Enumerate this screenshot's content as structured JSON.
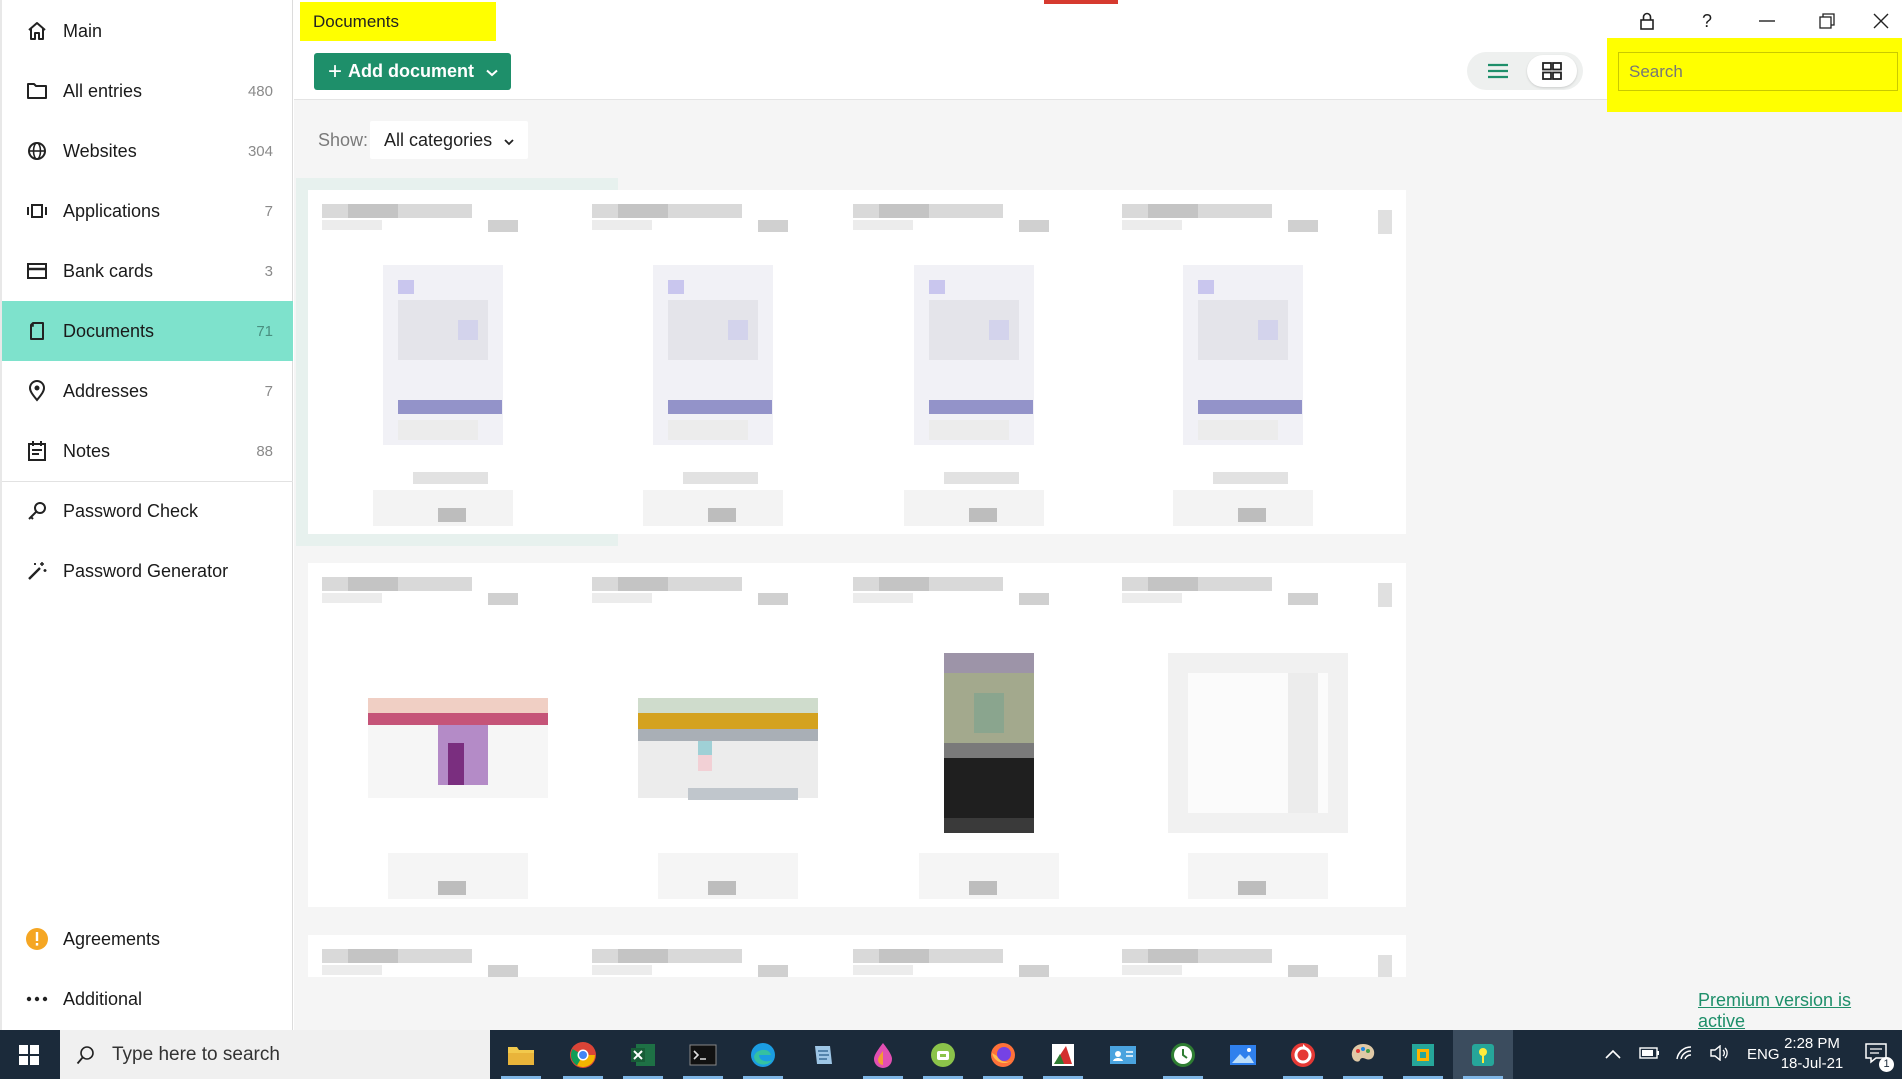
{
  "sidebar": {
    "items": [
      {
        "label": "Main",
        "count": "",
        "icon": "home-icon"
      },
      {
        "label": "All entries",
        "count": "480",
        "icon": "folder-icon"
      },
      {
        "label": "Websites",
        "count": "304",
        "icon": "globe-icon"
      },
      {
        "label": "Applications",
        "count": "7",
        "icon": "applications-icon"
      },
      {
        "label": "Bank cards",
        "count": "3",
        "icon": "credit-card-icon"
      },
      {
        "label": "Documents",
        "count": "71",
        "icon": "document-icon",
        "active": true
      },
      {
        "label": "Addresses",
        "count": "7",
        "icon": "location-pin-icon"
      },
      {
        "label": "Notes",
        "count": "88",
        "icon": "notes-icon"
      },
      {
        "label": "Password Check",
        "count": "",
        "icon": "key-icon"
      },
      {
        "label": "Password Generator",
        "count": "",
        "icon": "magic-wand-icon"
      }
    ],
    "bottom": [
      {
        "label": "Agreements",
        "icon": "warning-icon"
      },
      {
        "label": "Additional",
        "icon": "more-icon"
      }
    ]
  },
  "header": {
    "title": "Documents",
    "add_button": "Add document",
    "search_placeholder": "Search"
  },
  "filter": {
    "show_label": "Show:",
    "category": "All categories"
  },
  "footer": {
    "premium": "Premium version is active"
  },
  "taskbar": {
    "search_placeholder": "Type here to search",
    "language": "ENG",
    "time": "2:28 PM",
    "date": "18-Jul-21",
    "notification_count": "1"
  },
  "colors": {
    "accent": "#1e8f6a",
    "active_nav": "#7ee2cc",
    "highlight": "#ffff00"
  }
}
